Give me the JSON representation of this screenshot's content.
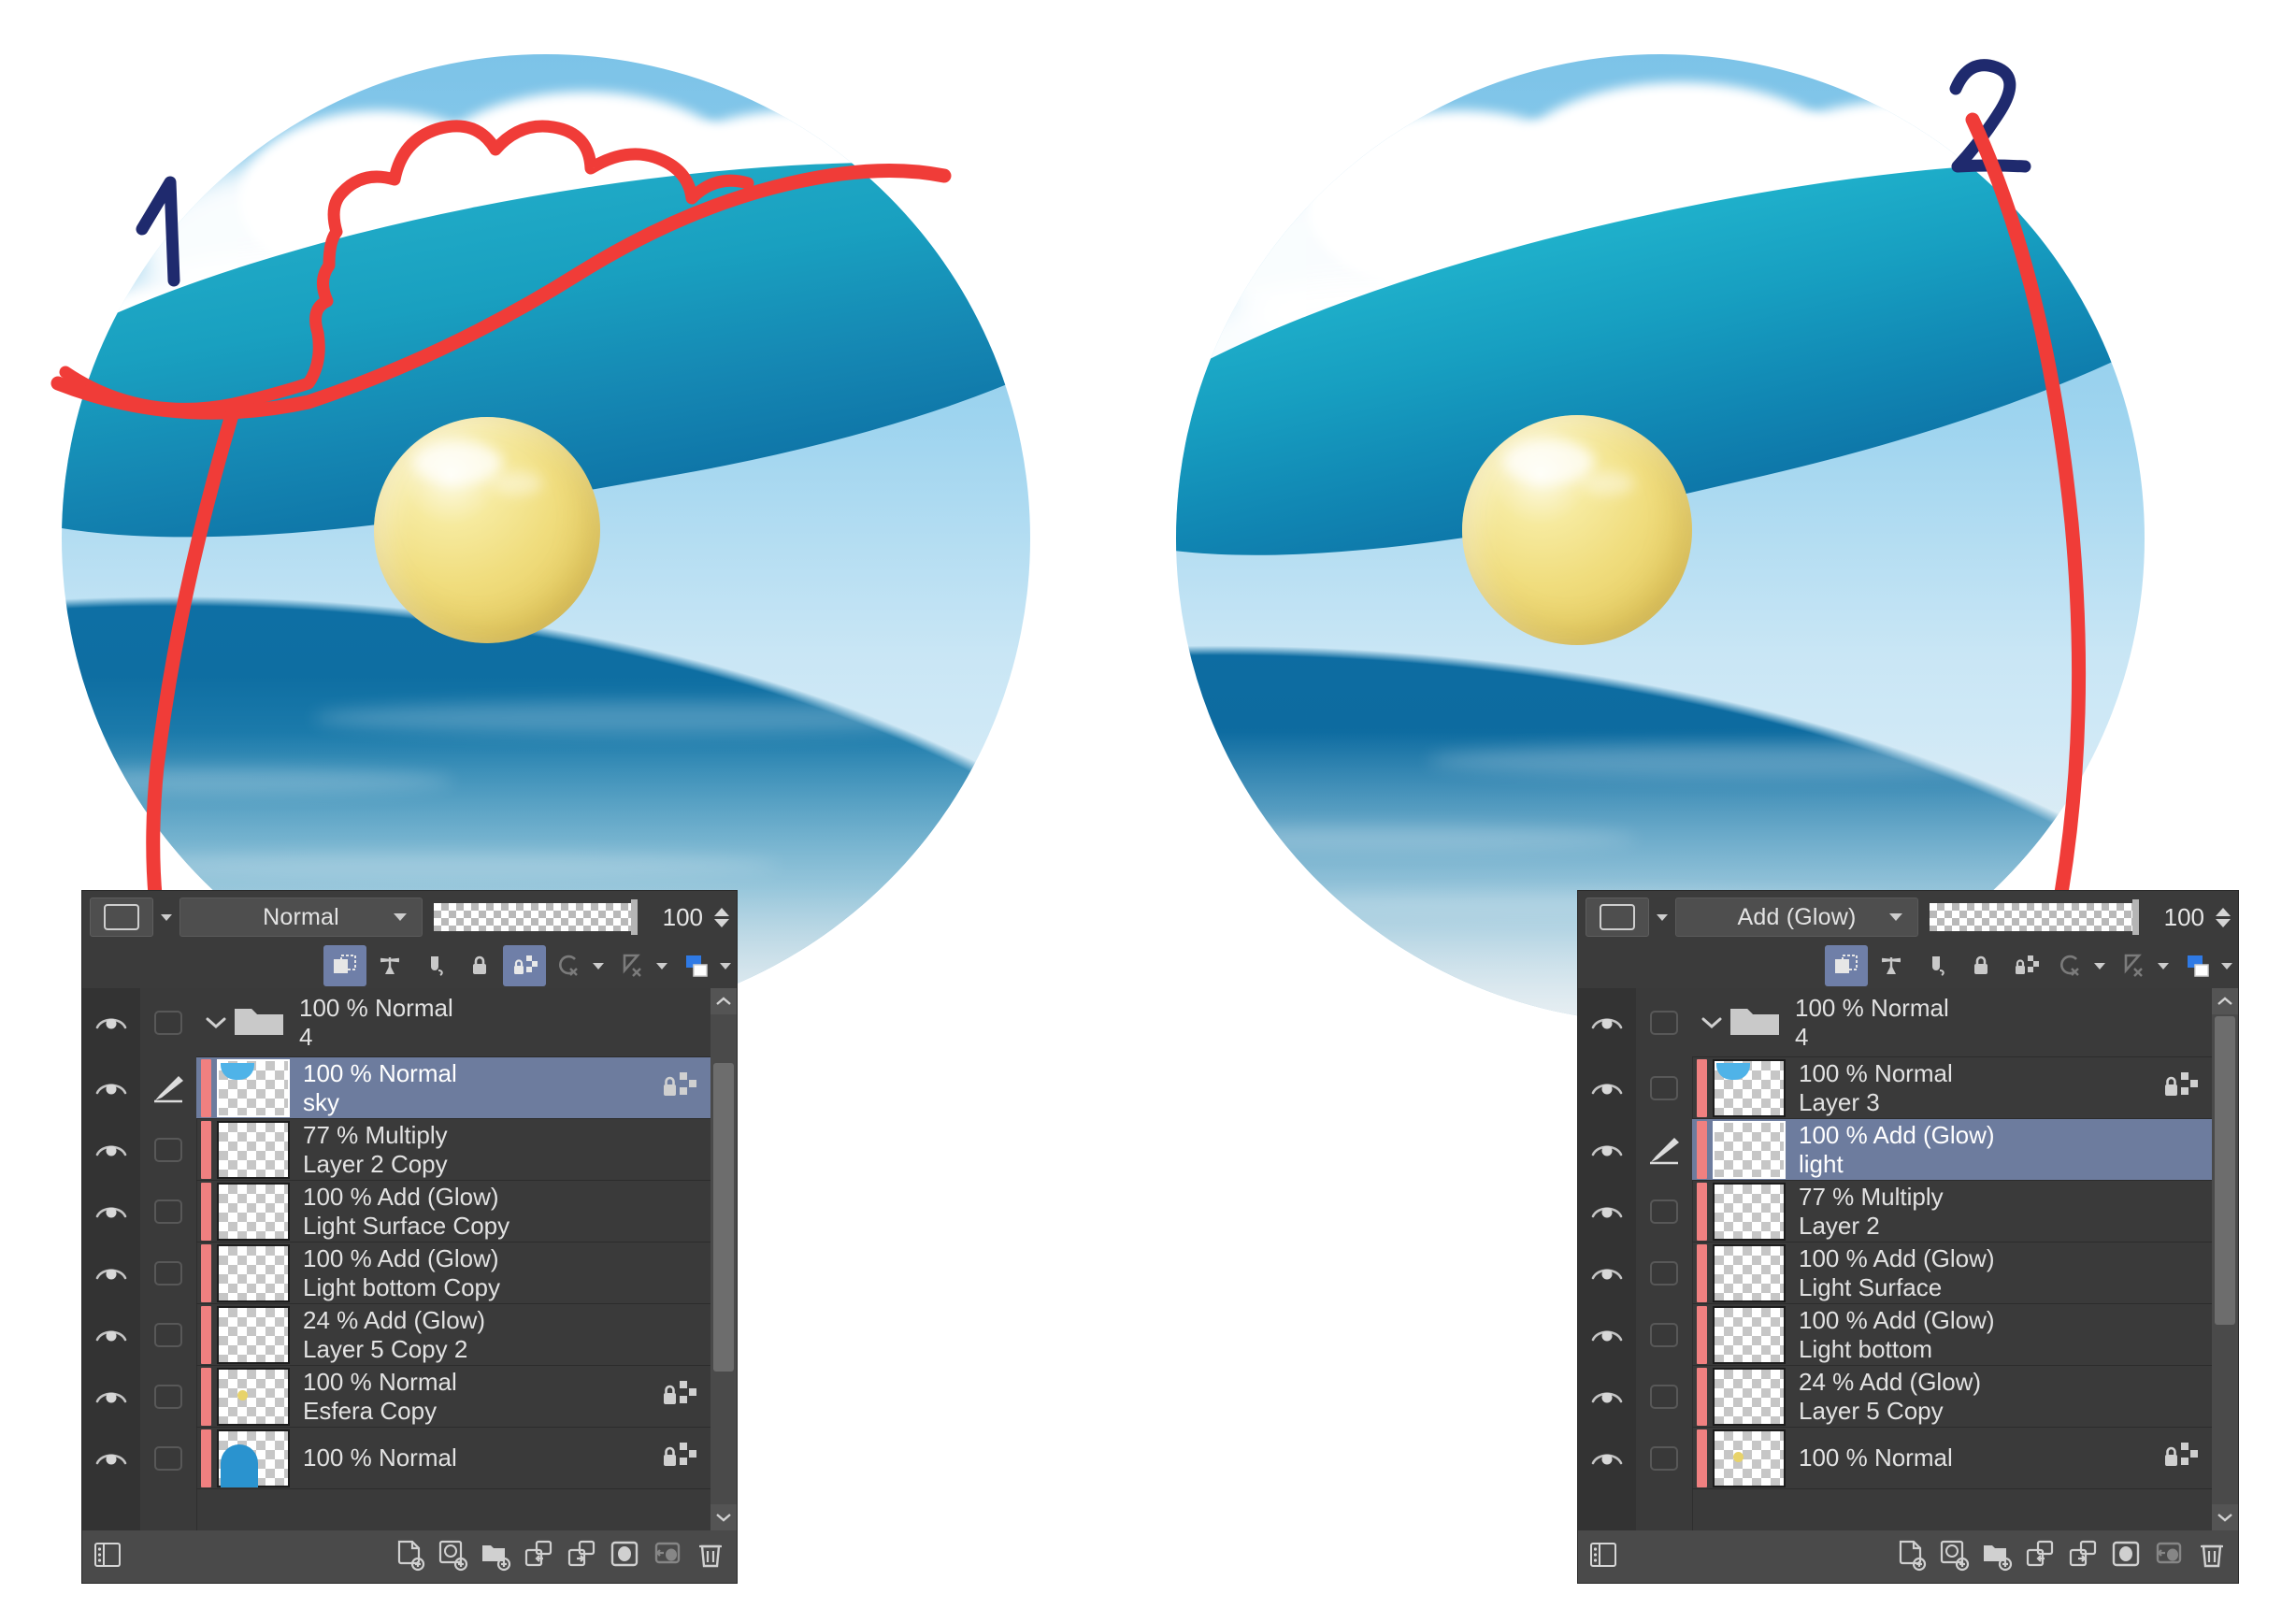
{
  "annotations": {
    "marker_one": "1",
    "marker_two": "2",
    "marker_color": "#1f2a6e",
    "highlight_color": "#f03c38"
  },
  "artwork": {
    "left": {
      "title": "underwater scene with sky, clouds and yellow sphere"
    },
    "right": {
      "title": "underwater scene with glow light layer and yellow sphere"
    }
  },
  "panel_left": {
    "blend_mode": "Normal",
    "opacity": "100",
    "tool_icons": [
      "clip-to-layer-below-icon",
      "transparent-pixel-lock-icon",
      "layer-mask-icon",
      "lock-layer-icon",
      "lock-transparent-pixels-icon",
      "reference-layer-icon",
      "draft-layer-icon",
      "palette-color-icon"
    ],
    "layers": [
      {
        "kind": "folder",
        "blend": "100 % Normal",
        "name": "4",
        "visible": true,
        "locked": false,
        "selected": false,
        "checkbox": true,
        "expanded": true
      },
      {
        "kind": "layer",
        "blend": "100 % Normal",
        "name": "sky",
        "visible": true,
        "locked": true,
        "selected": true,
        "checkbox": false,
        "thumb": "sky-thumb"
      },
      {
        "kind": "layer",
        "blend": "77 % Multiply",
        "name": "Layer 2 Copy",
        "visible": true,
        "locked": false,
        "selected": false,
        "checkbox": true,
        "thumb": "empty-thumb"
      },
      {
        "kind": "layer",
        "blend": "100 % Add (Glow)",
        "name": "Light Surface Copy",
        "visible": true,
        "locked": false,
        "selected": false,
        "checkbox": true,
        "thumb": "empty-thumb"
      },
      {
        "kind": "layer",
        "blend": "100 % Add (Glow)",
        "name": "Light bottom Copy",
        "visible": true,
        "locked": false,
        "selected": false,
        "checkbox": true,
        "thumb": "empty-thumb"
      },
      {
        "kind": "layer",
        "blend": "24 % Add (Glow)",
        "name": "Layer 5 Copy 2",
        "visible": true,
        "locked": false,
        "selected": false,
        "checkbox": true,
        "thumb": "empty-thumb"
      },
      {
        "kind": "layer",
        "blend": "100 % Normal",
        "name": "Esfera Copy",
        "visible": true,
        "locked": true,
        "selected": false,
        "checkbox": true,
        "thumb": "sphere-thumb"
      },
      {
        "kind": "layer",
        "blend": "100 % Normal",
        "name": "",
        "visible": true,
        "locked": true,
        "selected": false,
        "checkbox": true,
        "thumb": "blue-thumb"
      }
    ],
    "bottom_icons": [
      "layer-list-icon",
      "new-raster-layer-icon",
      "new-tone-layer-icon",
      "new-folder-icon",
      "transfer-down-icon",
      "combine-down-icon",
      "layer-mask-icon",
      "clip-mask-icon",
      "delete-layer-icon"
    ]
  },
  "panel_right": {
    "blend_mode": "Add (Glow)",
    "opacity": "100",
    "blend_mode_circled": true,
    "tool_icons": [
      "clip-to-layer-below-icon",
      "transparent-pixel-lock-icon",
      "layer-mask-icon",
      "lock-layer-icon",
      "lock-transparent-pixels-icon",
      "reference-layer-icon",
      "draft-layer-icon",
      "palette-color-icon"
    ],
    "layers": [
      {
        "kind": "folder",
        "blend": "100 % Normal",
        "name": "4",
        "visible": true,
        "locked": false,
        "selected": false,
        "checkbox": true,
        "expanded": true
      },
      {
        "kind": "layer",
        "blend": "100 % Normal",
        "name": "Layer 3",
        "visible": true,
        "locked": true,
        "selected": false,
        "checkbox": true,
        "thumb": "sky-thumb"
      },
      {
        "kind": "layer",
        "blend": "100 % Add (Glow)",
        "name": "light",
        "visible": true,
        "locked": false,
        "selected": true,
        "checkbox": false,
        "thumb": "empty-thumb"
      },
      {
        "kind": "layer",
        "blend": "77 % Multiply",
        "name": "Layer 2",
        "visible": true,
        "locked": false,
        "selected": false,
        "checkbox": true,
        "thumb": "empty-thumb"
      },
      {
        "kind": "layer",
        "blend": "100 % Add (Glow)",
        "name": "Light Surface",
        "visible": true,
        "locked": false,
        "selected": false,
        "checkbox": true,
        "thumb": "empty-thumb"
      },
      {
        "kind": "layer",
        "blend": "100 % Add (Glow)",
        "name": "Light bottom",
        "visible": true,
        "locked": false,
        "selected": false,
        "checkbox": true,
        "thumb": "empty-thumb"
      },
      {
        "kind": "layer",
        "blend": "24 % Add (Glow)",
        "name": "Layer 5 Copy",
        "visible": true,
        "locked": false,
        "selected": false,
        "checkbox": true,
        "thumb": "empty-thumb"
      },
      {
        "kind": "layer",
        "blend": "100 % Normal",
        "name": "",
        "visible": true,
        "locked": true,
        "selected": false,
        "checkbox": true,
        "thumb": "sphere-thumb"
      }
    ],
    "bottom_icons": [
      "layer-list-icon",
      "new-raster-layer-icon",
      "new-tone-layer-icon",
      "new-folder-icon",
      "transfer-down-icon",
      "combine-down-icon",
      "layer-mask-icon",
      "clip-mask-icon",
      "delete-layer-icon"
    ]
  }
}
